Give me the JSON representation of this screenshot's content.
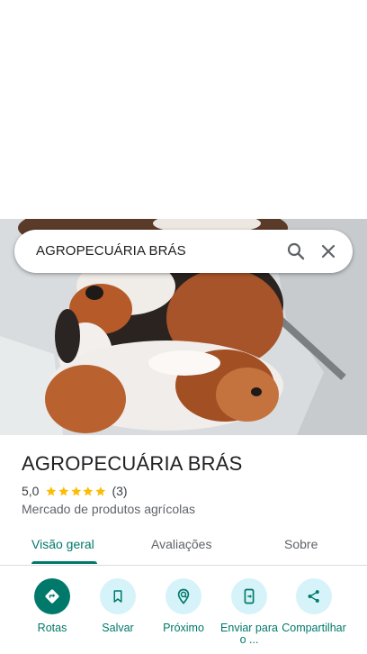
{
  "search": {
    "query": "AGROPECUÁRIA BRÁS"
  },
  "place": {
    "name": "AGROPECUÁRIA BRÁS",
    "rating_value": "5,0",
    "rating_stars": 5,
    "rating_count": "(3)",
    "category": "Mercado de produtos agrícolas"
  },
  "tabs": [
    {
      "label": "Visão geral",
      "active": true
    },
    {
      "label": "Avaliações",
      "active": false
    },
    {
      "label": "Sobre",
      "active": false
    }
  ],
  "actions": [
    {
      "label": "Rotas",
      "icon": "directions-icon"
    },
    {
      "label": "Salvar",
      "icon": "bookmark-icon"
    },
    {
      "label": "Próximo",
      "icon": "nearby-icon"
    },
    {
      "label": "Enviar para o ...",
      "icon": "send-to-phone-icon"
    },
    {
      "label": "Compartilhar",
      "icon": "share-icon"
    }
  ],
  "colors": {
    "accent": "#00796b",
    "action_bg": "#d6f3f9",
    "star": "#fbbc04",
    "text_primary": "#202124",
    "text_secondary": "#5f6368"
  }
}
